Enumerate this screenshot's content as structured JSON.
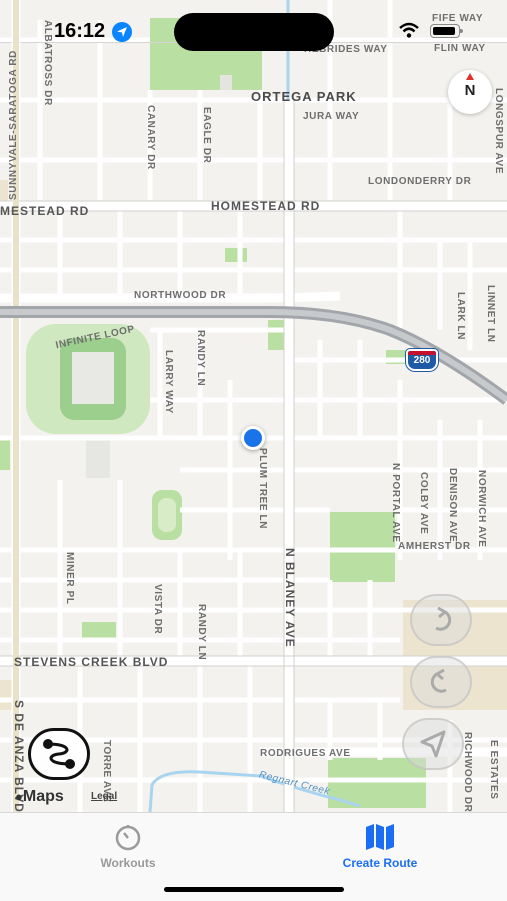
{
  "status_bar": {
    "time": "16:12"
  },
  "map": {
    "park_label": "ORTEGA PARK",
    "road_labels": {
      "fife_way": "FIFE WAY",
      "hebrides_way": "HEBRIDES WAY",
      "flin_way": "FLIN WAY",
      "jura_way": "JURA WAY",
      "londonderry_dr": "LONDONDERRY DR",
      "homestead_rd_left": "MESTEAD RD",
      "homestead_rd": "HOMESTEAD RD",
      "northwood_dr": "NORTHWOOD DR",
      "infinite_loop": "INFINITE LOOP",
      "amherst_dr": "AMHERST DR",
      "stevens_creek_blvd": "STEVENS CREEK BLVD",
      "rodrigues_ave": "RODRIGUES AVE",
      "regnart_creek": "Regnart Creek",
      "sunnyvale_saratoga_rd": "SUNNYVALE-SARATOGA RD",
      "albatross_dr": "ALBATROSS DR",
      "canary_dr": "CANARY DR",
      "eagle_dr": "EAGLE DR",
      "longspur_ave": "LONGSPUR AVE",
      "lark_ln": "LARK LN",
      "linnet_ln": "LINNET LN",
      "larry_way": "LARRY WAY",
      "randy_ln_top": "RANDY LN",
      "randy_ln_bottom": "RANDY LN",
      "plum_tree_ln": "PLUM TREE LN",
      "n_portal_ave": "N PORTAL AVE",
      "colby_ave": "COLBY AVE",
      "denison_ave": "DENISON AVE",
      "norwich_ave": "NORWICH AVE",
      "n_blaney_ave": "N BLANEY AVE",
      "miner_pl": "MINER PL",
      "vista_dr": "VISTA DR",
      "s_de_anza_blvd": "S DE ANZA BLVD",
      "torre_ave": "TORRE AVE",
      "richwood_dr": "RICHWOOD DR",
      "e_estates": "E ESTATES"
    },
    "highway_shield": "280",
    "compass_label": "N"
  },
  "attribution": {
    "maps": "Maps",
    "legal": "Legal"
  },
  "tabs": [
    {
      "label": "Workouts",
      "icon": "stopwatch-icon",
      "selected": false
    },
    {
      "label": "Create Route",
      "icon": "map-icon",
      "selected": true
    }
  ],
  "colors": {
    "accent": "#1b6ef3",
    "tab_inactive": "#9a9a9a",
    "location_dot": "#1a73e8",
    "park_green": "#b9dfa3",
    "highway": "#9ea3a8"
  }
}
